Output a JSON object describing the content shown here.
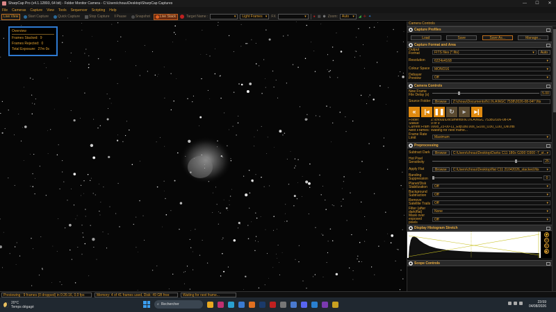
{
  "window": {
    "title": "SharpCap Pro (v4.1.12893, 64 bit) - Folder Monitor Camera - C:\\Users\\chouu\\Desktop\\SharpCap Captures",
    "controls": [
      "—",
      "☐",
      "✕"
    ]
  },
  "menu": [
    "File",
    "Cameras",
    "Capture",
    "View",
    "Tools",
    "Sequencer",
    "Scripting",
    "Help"
  ],
  "toolbar": {
    "live_view": "Live View",
    "start_capture": "Start Capture",
    "quick_capture": "Quick Capture",
    "stop_capture": "Stop Capture",
    "pause": "Pause",
    "snapshot": "Snapshot",
    "live_stack": "Live Stack",
    "target_name_label": "Target Name :",
    "target_name_value": "",
    "frame_type": "Light Frames",
    "fx_label": "FX",
    "fx_value": "",
    "zoom_label": "Zoom:",
    "zoom_value": "Auto"
  },
  "overview": {
    "title": "Overview",
    "rows": [
      {
        "label": "Frames Stacked:",
        "value": "9"
      },
      {
        "label": "Frames Rejected:",
        "value": "0"
      },
      {
        "label": "Total Exposure:",
        "value": "27m 0s"
      }
    ]
  },
  "panel": {
    "title": "Camera Controls",
    "capture_profiles": {
      "header": "Capture Profiles",
      "buttons": [
        "Load",
        "Save",
        "Save As...",
        "Manage..."
      ]
    },
    "capture_format": {
      "header": "Capture Format and Area",
      "output_format_label": "Output Format",
      "output_format_value": "FITS files (*.fits)",
      "auto_label": "Auto",
      "resolution_label": "Resolution",
      "resolution_value": "6224x4168",
      "colour_space_label": "Colour Space",
      "colour_space_value": "MONO16",
      "debayer_label": "Debayer Preview",
      "debayer_value": "Off"
    },
    "camera_controls": {
      "header": "Camera Controls",
      "delay_label": "New Frame File Delay (s)",
      "delay_value": "5.00",
      "source_folder_label": "Source Folder",
      "browse": "Browse",
      "source_folder_value": "Z:\\chouu\\Documents\\N.I.N.A\\NGC 7538\\2026-08-04\\*.fits",
      "folder_label": "Folder:",
      "folder_value": "Z:\\chouu\\Documents\\N.I.N.A\\NGC 7538\\2026-08-04",
      "status_label": "Status:",
      "status_value": "9 of 9",
      "current_frame_label": "Current Frame:",
      "current_frame_value": "0008_23-00-11_Exp180.00s_G100_O30_C00_OIII.fits",
      "next_frames_label": "Next Frames:",
      "next_frames_value": "Waiting for next frame...",
      "frame_rate_label": "Frame Rate Limit",
      "frame_rate_value": "Maximum"
    },
    "preprocessing": {
      "header": "Preprocessing",
      "subtract_dark_label": "Subtract Dark",
      "subtract_dark_value": "C:\\Users\\chouu\\Desktop\\Darks C11 180s G300 O300 -7_st...",
      "hot_pixel_label": "Hot Pixel Sensitivity",
      "hot_pixel_value": "25",
      "apply_flat_label": "Apply Flat",
      "apply_flat_value": "C:\\Users\\chouu\\Desktop\\flat C11 21042026_stacked.fits",
      "banding_label": "Banding Suppression",
      "banding_value": "0",
      "planet_label": "Planet/Disk Stabilization",
      "planet_value": "Off",
      "background_label": "Background Subtraction",
      "background_value": "Off",
      "satellite_label": "Remove Satellite Trails",
      "satellite_value": "Off",
      "filter_label": "Filter (after dark/flat)",
      "filter_value": "None",
      "mask_label": "Mask over exposed pixels",
      "mask_value": "Off"
    },
    "histogram": {
      "header": "Display Histogram Stretch"
    },
    "scope": {
      "header": "Scope Controls"
    }
  },
  "status": {
    "preview": "Previewing : 9 frames (0 dropped) in 0:26:16, 0.0 fps",
    "memory": "Memory: 4 of 41 frames used, Disk: 49 GB free",
    "waiting": "Waiting for next frame..."
  },
  "taskbar": {
    "temp": "20°C",
    "weather": "Temps dégagé",
    "search": "Rechercher",
    "time": "23:59",
    "date": "04/08/2026"
  },
  "colors": {
    "accent": "#e0a030",
    "highlight_border": "#2e7ad1",
    "live_stack": "#6a2a10"
  }
}
